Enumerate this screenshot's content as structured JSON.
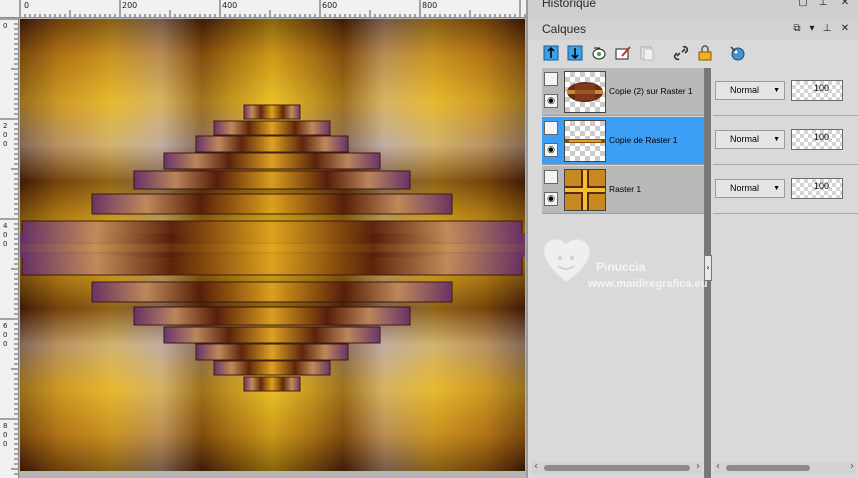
{
  "ruler": {
    "top_labels": [
      "0",
      "200",
      "400",
      "600",
      "800"
    ],
    "left_labels": [
      [
        "0"
      ],
      [
        "2",
        "0",
        "0"
      ],
      [
        "4",
        "0",
        "0"
      ],
      [
        "6",
        "0",
        "0"
      ],
      [
        "8",
        "0",
        "0"
      ]
    ]
  },
  "panels": {
    "history_title": "Historique",
    "layers_title": "Calques"
  },
  "toolbar": {
    "tools": [
      "new-raster-layer-icon",
      "new-vector-layer-icon",
      "group-layer-icon",
      "mask-layer-icon",
      "duplicate-layer-icon",
      "link-icon",
      "lock-icon",
      "palette-icon"
    ]
  },
  "layers": [
    {
      "name": "Copie (2) sur Raster 1",
      "blend": "Normal",
      "opacity": "100",
      "selected": false
    },
    {
      "name": "Copie de Raster 1",
      "blend": "Normal",
      "opacity": "100",
      "selected": true
    },
    {
      "name": "Raster 1",
      "blend": "Normal",
      "opacity": "100",
      "selected": false
    }
  ],
  "watermark": {
    "name": "Pinuccia",
    "url": "www.maidiregrafica.eu"
  },
  "colors": {
    "selected_row": "#3c9ff5",
    "gold": "#e8b020",
    "brown": "#5a2a0a",
    "purple": "#5a2868"
  }
}
